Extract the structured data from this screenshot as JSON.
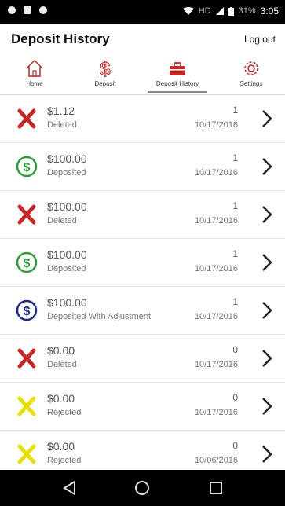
{
  "status_bar": {
    "network": "HD",
    "battery": "31%",
    "time": "3:05"
  },
  "header": {
    "title": "Deposit History",
    "logout": "Log out"
  },
  "tabs": [
    {
      "label": "Home",
      "icon": "home-icon"
    },
    {
      "label": "Deposit",
      "icon": "dollar-icon"
    },
    {
      "label": "Deposit History",
      "icon": "toolbox-icon",
      "active": true
    },
    {
      "label": "Settings",
      "icon": "gear-icon"
    }
  ],
  "rows": [
    {
      "amount": "$1.12",
      "status": "Deleted",
      "count": "1",
      "date": "10/17/2016",
      "icon": "red-x-icon"
    },
    {
      "amount": "$100.00",
      "status": "Deposited",
      "count": "1",
      "date": "10/17/2016",
      "icon": "green-dollar-icon"
    },
    {
      "amount": "$100.00",
      "status": "Deleted",
      "count": "1",
      "date": "10/17/2016",
      "icon": "red-x-icon"
    },
    {
      "amount": "$100.00",
      "status": "Deposited",
      "count": "1",
      "date": "10/17/2016",
      "icon": "green-dollar-icon"
    },
    {
      "amount": "$100.00",
      "status": "Deposited With Adjustment",
      "count": "1",
      "date": "10/17/2016",
      "icon": "blue-dollar-icon"
    },
    {
      "amount": "$0.00",
      "status": "Deleted",
      "count": "0",
      "date": "10/17/2016",
      "icon": "red-x-icon"
    },
    {
      "amount": "$0.00",
      "status": "Rejected",
      "count": "0",
      "date": "10/17/2016",
      "icon": "yellow-x-icon"
    },
    {
      "amount": "$0.00",
      "status": "Rejected",
      "count": "0",
      "date": "10/06/2016",
      "icon": "yellow-x-icon"
    }
  ],
  "colors": {
    "accent_red": "#c62828",
    "green": "#2e9e3a",
    "blue": "#1a2a8a",
    "yellow": "#e8e000"
  },
  "nav": [
    "back-icon",
    "home-circle-icon",
    "recents-icon"
  ]
}
